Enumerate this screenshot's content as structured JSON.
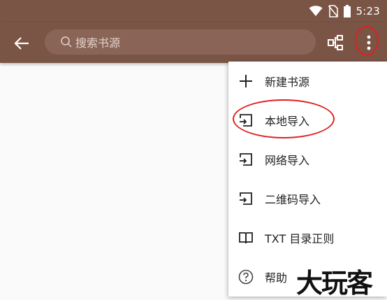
{
  "status_bar": {
    "time": "5:23",
    "icons": [
      "wifi-icon",
      "no-sim-icon",
      "battery-icon"
    ]
  },
  "toolbar": {
    "search_placeholder": "搜索书源",
    "icons": [
      "back-arrow-icon",
      "search-icon",
      "group-icon",
      "more-vert-icon"
    ]
  },
  "menu": {
    "items": [
      {
        "label": "新建书源",
        "icon": "plus-icon"
      },
      {
        "label": "本地导入",
        "icon": "import-icon"
      },
      {
        "label": "网络导入",
        "icon": "import-icon"
      },
      {
        "label": "二维码导入",
        "icon": "import-icon"
      },
      {
        "label": "TXT 目录正则",
        "icon": "book-icon"
      },
      {
        "label": "帮助",
        "icon": "help-icon"
      }
    ]
  },
  "watermark": {
    "text": "大玩客"
  },
  "colors": {
    "toolbar": "#7a5445",
    "search_box": "#8a6557",
    "annotation": "#e02020",
    "background": "#fafafa"
  }
}
